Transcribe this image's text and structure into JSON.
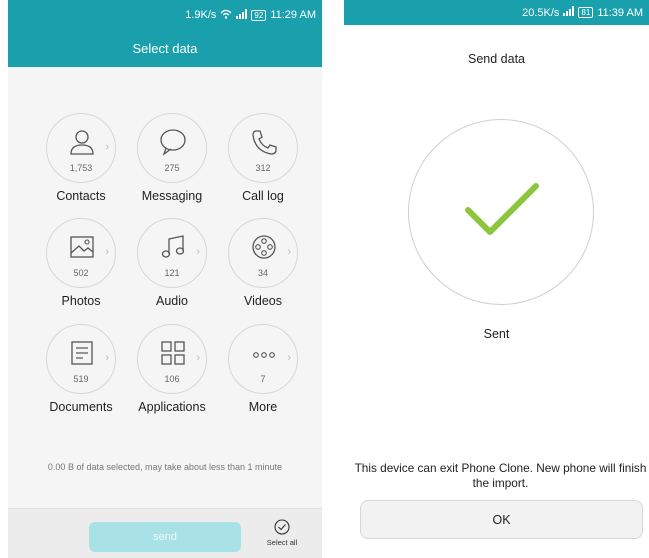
{
  "left": {
    "status": {
      "speed": "1.9K/s",
      "battery": "92",
      "time": "11:29 AM"
    },
    "title": "Select data",
    "items": [
      {
        "label": "Contacts",
        "count": "1,753",
        "icon": "person-icon"
      },
      {
        "label": "Messaging",
        "count": "275",
        "icon": "chat-bubble-icon"
      },
      {
        "label": "Call log",
        "count": "312",
        "icon": "phone-icon"
      },
      {
        "label": "Photos",
        "count": "502",
        "icon": "image-icon"
      },
      {
        "label": "Audio",
        "count": "121",
        "icon": "music-note-icon"
      },
      {
        "label": "Videos",
        "count": "34",
        "icon": "film-reel-icon"
      },
      {
        "label": "Documents",
        "count": "519",
        "icon": "document-icon"
      },
      {
        "label": "Applications",
        "count": "106",
        "icon": "app-grid-icon"
      },
      {
        "label": "More",
        "count": "7",
        "icon": "more-dots-icon"
      }
    ],
    "hint": "0.00 B of data selected, may take about less than 1 minute",
    "send_label": "send",
    "select_all_label": "Select all"
  },
  "right": {
    "status": {
      "speed": "20.5K/s",
      "battery": "81",
      "time": "11:39 AM"
    },
    "title": "Send data",
    "status_label": "Sent",
    "message_line1": "This device can exit Phone Clone. New phone will finish",
    "message_line2": "the import.",
    "ok_label": "OK"
  },
  "colors": {
    "accent": "#1aa0ad",
    "check": "#8cc63f",
    "send_disabled": "#a9e2e6"
  }
}
